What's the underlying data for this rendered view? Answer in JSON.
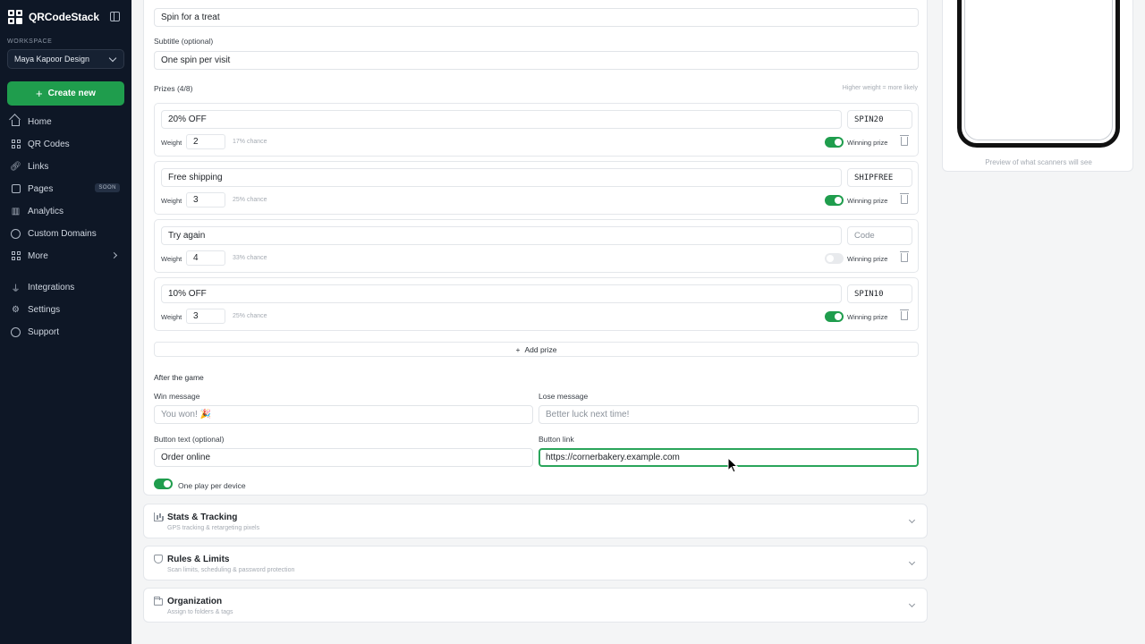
{
  "app": {
    "brand": "QRCodeStack",
    "workspace_label": "WORKSPACE",
    "workspace_name": "Maya Kapoor Design",
    "create_button": "Create new"
  },
  "nav": {
    "home": "Home",
    "qr_codes": "QR Codes",
    "links": "Links",
    "pages": "Pages",
    "pages_badge": "SOON",
    "analytics": "Analytics",
    "custom_domains": "Custom Domains",
    "more": "More",
    "integrations": "Integrations",
    "settings": "Settings",
    "support": "Support"
  },
  "form": {
    "title_value": "Spin for a treat",
    "subtitle_label": "Subtitle (optional)",
    "subtitle_value": "One spin per visit",
    "prizes_label": "Prizes (4/8)",
    "prizes_hint": "Higher weight = more likely",
    "weight_label": "Weight",
    "winning_label": "Winning prize",
    "code_placeholder": "Code",
    "prizes": [
      {
        "name": "20% OFF",
        "code": "SPIN20",
        "weight": "2",
        "chance": "17% chance",
        "winning": true
      },
      {
        "name": "Free shipping",
        "code": "SHIPFREE",
        "weight": "3",
        "chance": "25% chance",
        "winning": true
      },
      {
        "name": "Try again",
        "code": "",
        "weight": "4",
        "chance": "33% chance",
        "winning": false
      },
      {
        "name": "10% OFF",
        "code": "SPIN10",
        "weight": "3",
        "chance": "25% chance",
        "winning": true
      }
    ],
    "add_prize": "Add prize",
    "after_game": "After the game",
    "win_message_label": "Win message",
    "win_message_placeholder": "You won! 🎉",
    "lose_message_label": "Lose message",
    "lose_message_placeholder": "Better luck next time!",
    "button_text_label": "Button text (optional)",
    "button_text_value": "Order online",
    "button_link_label": "Button link",
    "button_link_value": "https://cornerbakery.example.com",
    "one_play_label": "One play per device",
    "one_play_enabled": true
  },
  "sections": [
    {
      "title": "Stats & Tracking",
      "subtitle": "GPS tracking & retargeting pixels",
      "icon": "chart-icon"
    },
    {
      "title": "Rules & Limits",
      "subtitle": "Scan limits, scheduling & password protection",
      "icon": "shield-icon"
    },
    {
      "title": "Organization",
      "subtitle": "Assign to folders & tags",
      "icon": "folder-icon"
    }
  ],
  "preview": {
    "caption": "Preview of what scanners will see"
  },
  "colors": {
    "sidebar_bg": "#0e1726",
    "accent_green": "#1f9d4d",
    "focus_border": "#2aa55b"
  }
}
